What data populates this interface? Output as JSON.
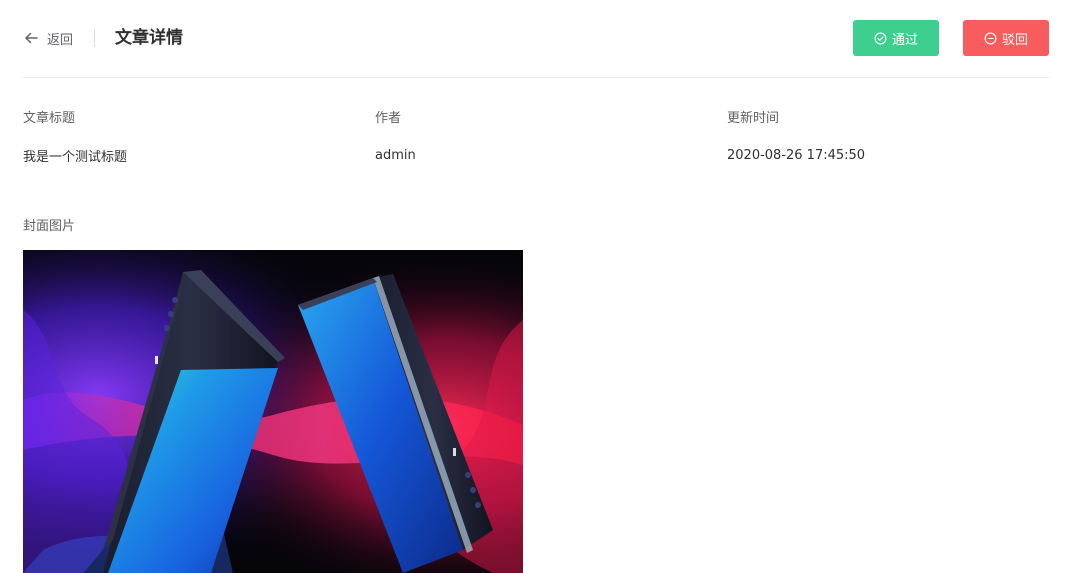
{
  "header": {
    "back_label": "返回",
    "title": "文章详情",
    "approve_label": "通过",
    "reject_label": "驳回"
  },
  "details": {
    "title_label": "文章标题",
    "title_value": "我是一个测试标题",
    "author_label": "作者",
    "author_value": "admin",
    "updated_label": "更新时间",
    "updated_value": "2020-08-26 17:45:50"
  },
  "cover": {
    "label": "封面图片"
  },
  "colors": {
    "approve": "#3ecf8e",
    "reject": "#f85c5c"
  },
  "icons": {
    "back": "arrow-left-icon",
    "approve": "check-circle-icon",
    "reject": "minus-circle-icon"
  }
}
